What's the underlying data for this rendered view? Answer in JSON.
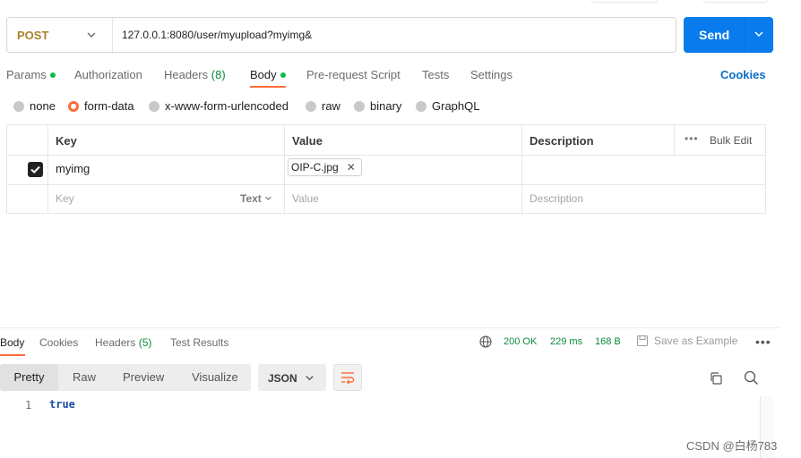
{
  "request": {
    "method": "POST",
    "url": "127.0.0.1:8080/user/myupload?myimg&",
    "send_label": "Send"
  },
  "request_tabs": [
    {
      "label": "Params",
      "has_dot": true
    },
    {
      "label": "Authorization"
    },
    {
      "label": "Headers",
      "count": "(8)"
    },
    {
      "label": "Body",
      "has_dot": true,
      "active": true
    },
    {
      "label": "Pre-request Script"
    },
    {
      "label": "Tests"
    },
    {
      "label": "Settings"
    }
  ],
  "cookies_label": "Cookies",
  "body_types": [
    {
      "label": "none",
      "selected": false
    },
    {
      "label": "form-data",
      "selected": true
    },
    {
      "label": "x-www-form-urlencoded",
      "selected": false
    },
    {
      "label": "raw",
      "selected": false
    },
    {
      "label": "binary",
      "selected": false
    },
    {
      "label": "GraphQL",
      "selected": false
    }
  ],
  "params_table": {
    "headers": {
      "key": "Key",
      "value": "Value",
      "description": "Description",
      "bulk_edit": "Bulk Edit"
    },
    "rows": [
      {
        "checked": true,
        "key": "myimg",
        "value": "OIP-C.jpg",
        "description": ""
      }
    ],
    "placeholder_row": {
      "key": "Key",
      "type": "Text",
      "value": "Value",
      "description": "Description"
    }
  },
  "response_tabs": [
    {
      "label": "Body",
      "active": true
    },
    {
      "label": "Cookies"
    },
    {
      "label": "Headers",
      "count": "(5)"
    },
    {
      "label": "Test Results"
    }
  ],
  "response_meta": {
    "status": "200 OK",
    "time": "229 ms",
    "size": "168 B",
    "save_as_example": "Save as Example"
  },
  "view_modes": [
    "Pretty",
    "Raw",
    "Preview",
    "Visualize"
  ],
  "active_view": "Pretty",
  "format": "JSON",
  "response_body": {
    "line_number": "1",
    "value": "true"
  },
  "watermark": "CSDN @白杨783",
  "colors": {
    "accent": "#ff6c37",
    "send": "#097bed",
    "method": "#a9832b",
    "status_ok": "#0a8a39"
  }
}
